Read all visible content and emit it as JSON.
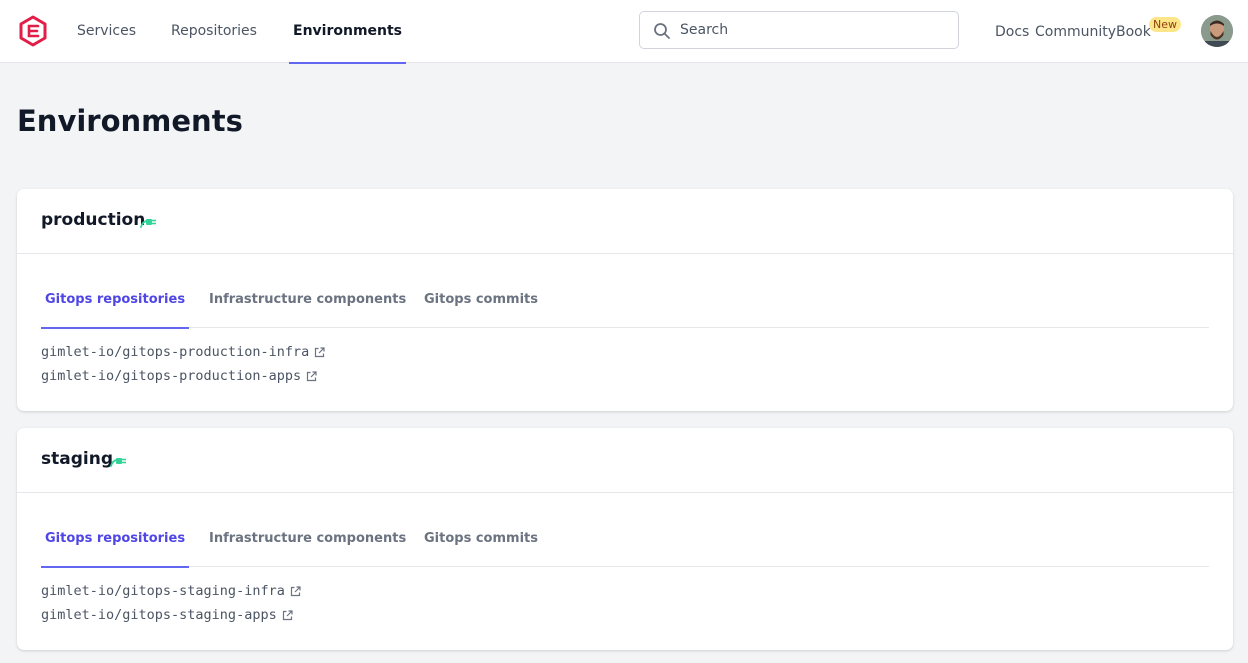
{
  "nav": {
    "items": [
      {
        "label": "Services",
        "active": false
      },
      {
        "label": "Repositories",
        "active": false
      },
      {
        "label": "Environments",
        "active": true
      }
    ]
  },
  "search": {
    "placeholder": "Search",
    "value": ""
  },
  "header_links": {
    "docs": "Docs",
    "community": "Community",
    "book": "Book",
    "book_badge": "New"
  },
  "page": {
    "title": "Environments"
  },
  "environments": [
    {
      "name": "production",
      "tabs": [
        {
          "label": "Gitops repositories",
          "active": true
        },
        {
          "label": "Infrastructure components",
          "active": false
        },
        {
          "label": "Gitops commits",
          "active": false
        }
      ],
      "repositories": [
        "gimlet-io/gitops-production-infra",
        "gimlet-io/gitops-production-apps"
      ]
    },
    {
      "name": "staging",
      "tabs": [
        {
          "label": "Gitops repositories",
          "active": true
        },
        {
          "label": "Infrastructure components",
          "active": false
        },
        {
          "label": "Gitops commits",
          "active": false
        }
      ],
      "repositories": [
        "gimlet-io/gitops-staging-infra",
        "gimlet-io/gitops-staging-apps"
      ]
    }
  ],
  "colors": {
    "accent": "#6366f1",
    "accent_text": "#4f46e5",
    "connected": "#34d399",
    "logo": "#e11d48",
    "badge_bg": "#fde68a"
  },
  "icons": {
    "logo": "gimlet-logo",
    "search": "search-icon",
    "connected": "plug-icon",
    "external": "external-link-icon"
  }
}
